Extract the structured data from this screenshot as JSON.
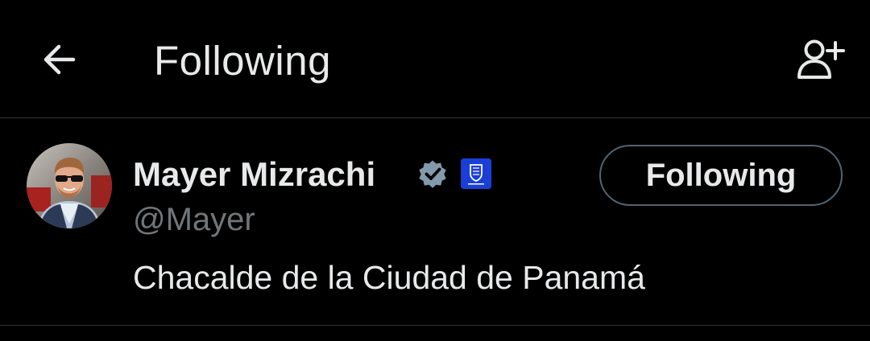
{
  "header": {
    "back_icon": "arrow-left-icon",
    "title": "Following",
    "add_user_icon": "person-add-icon"
  },
  "user": {
    "display_name": "Mayer Mizrachi",
    "verified_icon": "verified-badge-icon",
    "affiliate_icon": "affiliate-badge-icon",
    "handle": "@Mayer",
    "bio": "Chacalde de la Ciudad de Panamá",
    "follow_button_label": "Following"
  },
  "colors": {
    "background": "#000000",
    "primary_text": "#e7e9ea",
    "secondary_text": "#71767b",
    "divider": "#2f3336",
    "verified_gray": "#829aab",
    "affiliate_blue": "#1a3fd6"
  }
}
